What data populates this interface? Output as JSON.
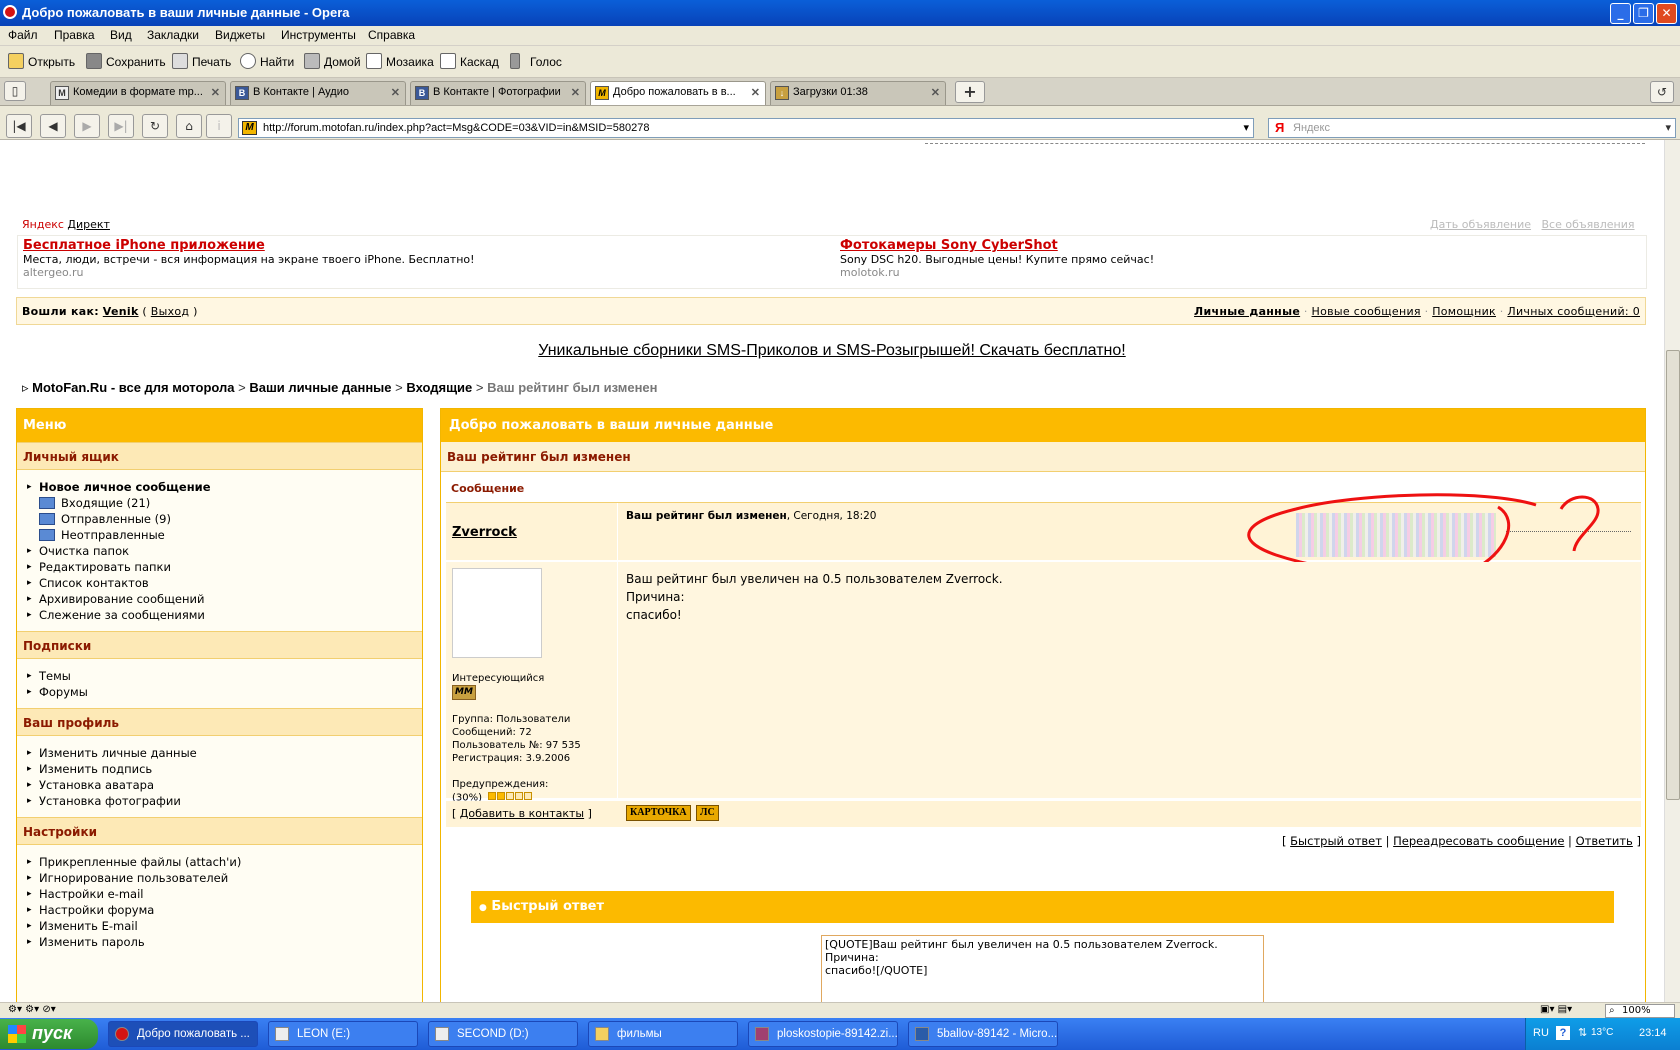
{
  "window": {
    "title": "Добро пожаловать в ваши личные данные - Opera"
  },
  "menu": [
    "Файл",
    "Правка",
    "Вид",
    "Закладки",
    "Виджеты",
    "Инструменты",
    "Справка"
  ],
  "toolbar": [
    "Открыть",
    "Сохранить",
    "Печать",
    "Найти",
    "Домой",
    "Мозаика",
    "Каскад",
    "Голос"
  ],
  "tabs": [
    {
      "label": "Комедии в формате mp...",
      "favicon": "М"
    },
    {
      "label": "В Контакте | Аудио",
      "favicon": "В"
    },
    {
      "label": "В Контакте | Фотографии",
      "favicon": "В"
    },
    {
      "label": "Добро пожаловать в в...",
      "favicon": "M"
    },
    {
      "label": "Загрузки 01:38",
      "favicon": "↓"
    }
  ],
  "address": {
    "url": "http://forum.motofan.ru/index.php?act=Msg&CODE=03&VID=in&MSID=580278",
    "search_placeholder": "Яндекс"
  },
  "yandex": {
    "brand1": "Яндекс",
    "brand2": "Директ",
    "link_give": "Дать объявление",
    "link_all": "Все объявления",
    "ads": [
      {
        "title": "Бесплатное iPhone приложение",
        "desc": "Места, люди, встречи - вся информация на экране твоего iPhone. Бесплатно!",
        "domain": "altergeo.ru"
      },
      {
        "title": "Фотокамеры Sony CyberShot",
        "desc": "Sony DSC h20. Выгодные цены! Купите прямо сейчас!",
        "domain": "molotok.ru"
      }
    ]
  },
  "login": {
    "prefix": "Вошли как:",
    "user": "Venik",
    "open": "(",
    "logout": "Выход",
    "close": ")",
    "links": [
      "Личные данные",
      "Новые сообщения",
      "Помощник",
      "Личных сообщений: 0"
    ],
    "dot": "·"
  },
  "promo": "Уникальные сборники SMS-Приколов и SMS-Розыгрышей! Скачать бесплатно!",
  "breadcrumb": {
    "marker": "▹",
    "items": [
      "MotoFan.Ru - все для моторола",
      "Ваши личные данные",
      "Входящие"
    ],
    "current": "Ваш рейтинг был изменен",
    "sep": ">"
  },
  "sidebar": {
    "title": "Меню",
    "sections": [
      {
        "title": "Личный ящик",
        "items": [
          "Новое личное сообщение",
          "Входящие (21)",
          "Отправленные (9)",
          "Неотправленные",
          "Очистка папок",
          "Редактировать папки",
          "Список контактов",
          "Архивирование сообщений",
          "Слежение за сообщениями"
        ]
      },
      {
        "title": "Подписки",
        "items": [
          "Темы",
          "Форумы"
        ]
      },
      {
        "title": "Ваш профиль",
        "items": [
          "Изменить личные данные",
          "Изменить подпись",
          "Установка аватара",
          "Установка фотографии"
        ]
      },
      {
        "title": "Настройки",
        "items": [
          "Прикрепленные файлы (attach'и)",
          "Игнорирование пользователей",
          "Настройки e-mail",
          "Настройки форума",
          "Изменить E-mail",
          "Изменить пароль"
        ]
      }
    ]
  },
  "main": {
    "title": "Добро пожаловать в ваши личные данные",
    "subject": "Ваш рейтинг был изменен",
    "msg_label": "Сообщение",
    "author": "Zverrock",
    "msg_title": "Ваш рейтинг был изменен",
    "msg_time": ", Сегодня, 18:20",
    "body": [
      "Ваш рейтинг был увеличен на 0.5 пользователем Zverrock.",
      "Причина:",
      "спасибо!"
    ],
    "user_status": "Интересующийся",
    "badge": "MM",
    "group": "Группа: Пользователи",
    "posts": "Сообщений: 72",
    "user_no": "Пользователь №: 97 535",
    "reg": "Регистрация: 3.9.2006",
    "warn_label": "Предупреждения:",
    "warn_open": "(",
    "warn_pct": "30",
    "warn_close": "%)",
    "warn_level": 0.3,
    "add_contact": "Добавить в контакты",
    "bracket_open": "[",
    "bracket_close": "]",
    "pipe": "|",
    "btn_card": "КАРТОЧКА",
    "btn_pm": "ЛС",
    "actions": [
      "Быстрый ответ",
      "Переадресовать сообщение",
      "Ответить"
    ],
    "quick_reply_title": "Быстрый ответ",
    "quick_reply_text": "[QUOTE]Ваш рейтинг был увеличен на 0.5 пользователем Zverrock.\nПричина:\nспасибо![/QUOTE]",
    "annotation": "?"
  },
  "status": {
    "zoom": "100%"
  },
  "taskbar": {
    "start": "пуск",
    "tasks": [
      "Добро пожаловать ...",
      "LEON (E:)",
      "SECOND (D:)",
      "фильмы",
      "ploskostopie-89142.zi...",
      "5ballov-89142 - Micro..."
    ],
    "lang": "RU",
    "temp": "13°C",
    "time": "23:14"
  },
  "colors": {
    "accent": "#fcba00",
    "header_text": "#8b1a00",
    "ad_title": "#cc0000",
    "annotation": "#ee1111"
  }
}
